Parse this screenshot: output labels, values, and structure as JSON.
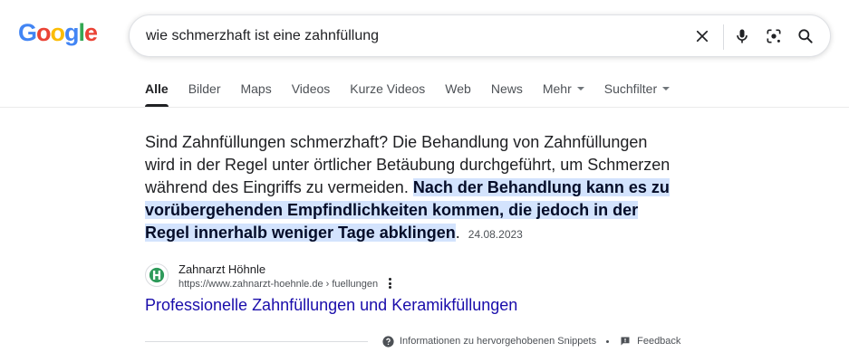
{
  "logo": {
    "letters": [
      "G",
      "o",
      "o",
      "g",
      "l",
      "e"
    ],
    "colors": [
      "#4285F4",
      "#EA4335",
      "#FBBC05",
      "#4285F4",
      "#34A853",
      "#EA4335"
    ]
  },
  "search": {
    "query": "wie schmerzhaft ist eine zahnfüllung"
  },
  "tabs": [
    {
      "label": "Alle",
      "active": true
    },
    {
      "label": "Bilder"
    },
    {
      "label": "Maps"
    },
    {
      "label": "Videos"
    },
    {
      "label": "Kurze Videos"
    },
    {
      "label": "Web"
    },
    {
      "label": "News"
    },
    {
      "label": "Mehr",
      "dropdown": true
    },
    {
      "label": "Suchfilter",
      "dropdown": true
    }
  ],
  "snippet": {
    "text_plain": "Sind Zahnfüllungen schmerzhaft? Die Behandlung von Zahnfüllungen wird in der Regel unter örtlicher Betäubung durchgeführt, um Schmerzen während des Eingriffs zu vermeiden. ",
    "text_highlight": "Nach der Behandlung kann es zu vorübergehenden Empfindlichkeiten kommen, die jedoch in der Regel innerhalb weniger Tage abklingen",
    "text_end": ".",
    "date": "24.08.2023"
  },
  "source": {
    "site_name": "Zahnarzt Höhnle",
    "url": "https://www.zahnarzt-hoehnle.de › fuellungen",
    "favicon_color": "#2e9a5a"
  },
  "result": {
    "title": "Professionelle Zahnfüllungen und Keramikfüllungen"
  },
  "footer": {
    "about_label": "Informationen zu hervorgehobenen Snippets",
    "feedback_label": "Feedback"
  }
}
